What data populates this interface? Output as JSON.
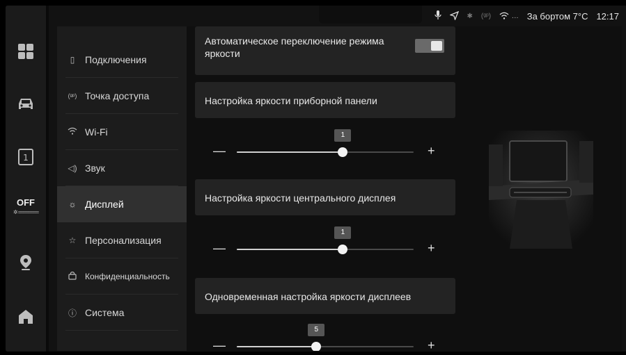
{
  "status": {
    "outside_temp": "За бортом 7°C",
    "time": "12:17",
    "wifi_dots": "···",
    "signal_text": "(ᵍᵖ)"
  },
  "dock": {
    "off_label": "OFF",
    "fan_label": "✲ ========"
  },
  "menu": {
    "items": [
      {
        "label": "Подключения",
        "icon": "phone-icon"
      },
      {
        "label": "Точка доступа",
        "icon": "hotspot-icon"
      },
      {
        "label": "Wi-Fi",
        "icon": "wifi-icon"
      },
      {
        "label": "Звук",
        "icon": "speaker-icon"
      },
      {
        "label": "Дисплей",
        "icon": "sun-icon"
      },
      {
        "label": "Персонализация",
        "icon": "star-icon"
      },
      {
        "label": "Конфиденциальность",
        "icon": "lock-icon"
      },
      {
        "label": "Система",
        "icon": "info-icon"
      }
    ],
    "active_index": 4
  },
  "settings": {
    "auto_brightness": {
      "label": "Автоматическое переключение режима яркости",
      "enabled": true
    },
    "dashboard_brightness": {
      "label": "Настройка яркости приборной панели",
      "value": "1",
      "fraction": 0.6
    },
    "center_display_brightness": {
      "label": "Настройка яркости центрального дисплея",
      "value": "1",
      "fraction": 0.6
    },
    "all_displays_brightness": {
      "label": "Одновременная настройка яркости дисплеев",
      "value": "5",
      "fraction": 0.45
    }
  },
  "slider_symbols": {
    "minus": "—",
    "plus": "+"
  },
  "colors": {
    "background": "#121212",
    "active_menu": "#303030",
    "card": "#232323"
  }
}
